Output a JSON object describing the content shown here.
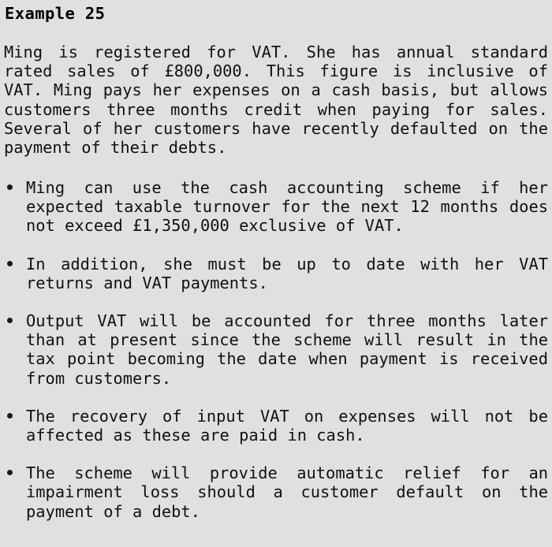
{
  "page": {
    "background_color": "#e0e0e0",
    "text_color": "#111111",
    "title": "Example 25"
  },
  "intro": {
    "paragraph": "Ming is registered for VAT. She has annual standard rated sales of £800,000. This figure is inclusive of VAT. Ming pays her expenses on a cash basis, but allows customers three months credit when paying for sales. Several of her customers have recently defaulted on the payment of their debts."
  },
  "bullets": {
    "marker": "bullet-dot",
    "items": [
      {
        "text": "Ming can use the cash accounting scheme if her expected taxable turnover for the next 12 months does not exceed £1,350,000 exclusive of VAT."
      },
      {
        "text": "In addition, she must be up to date with her VAT returns and VAT payments."
      },
      {
        "text": "Output VAT will be accounted for three months later than at present since the scheme will result in the tax point becoming the date when payment is received from customers."
      },
      {
        "text": "The recovery of input VAT on expenses will not be affected as these are paid in cash."
      },
      {
        "text": "The scheme will provide automatic relief for an impairment loss should a customer default on the payment of a debt."
      }
    ]
  }
}
